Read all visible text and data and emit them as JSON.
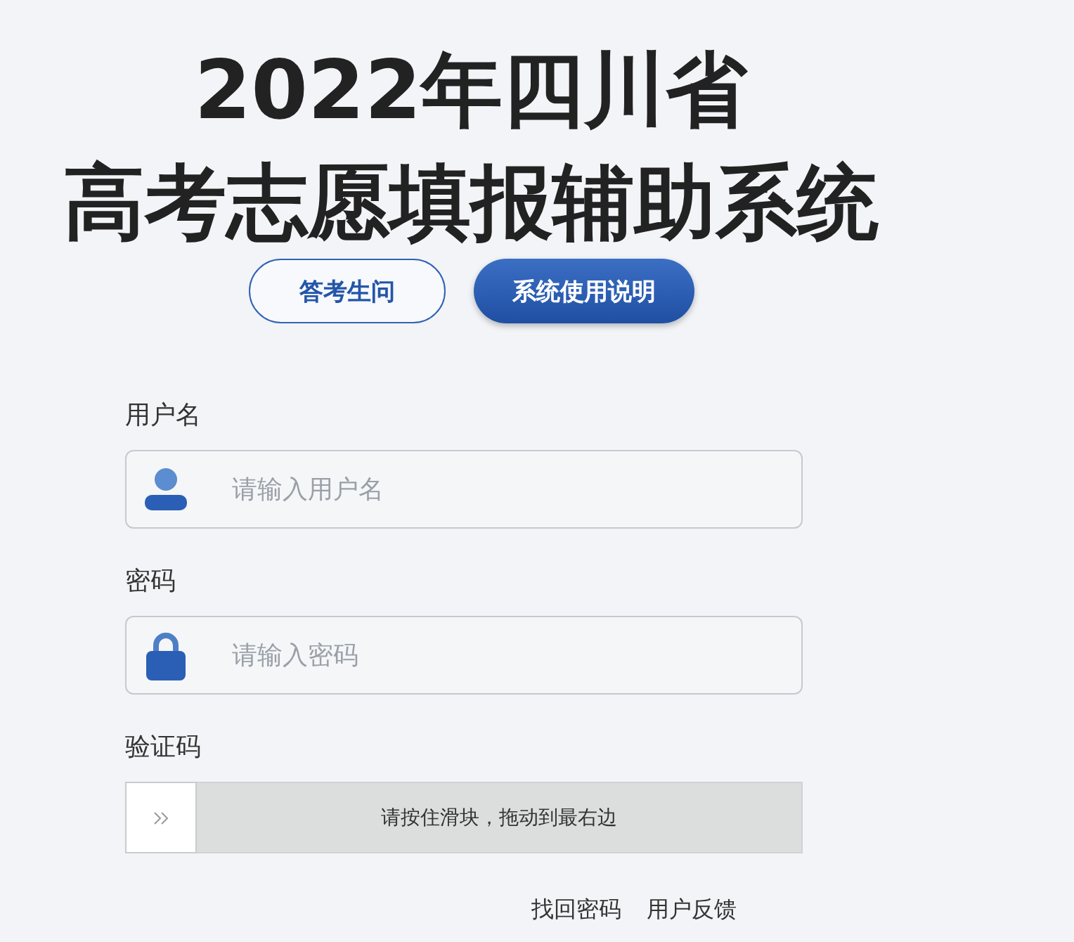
{
  "title_lines": [
    "2022年四川省",
    "高考志愿填报辅助系统"
  ],
  "buttons": [
    {
      "label": "答考生问",
      "kind": "outline"
    },
    {
      "label": "系统使用说明",
      "kind": "filled"
    }
  ],
  "fields": [
    {
      "label": "用户名",
      "kind": "user",
      "placeholder": "请输入用户名"
    },
    {
      "label": "密码",
      "kind": "lock",
      "placeholder": "请输入密码"
    }
  ],
  "captcha": {
    "label": "验证码",
    "hint": "请按住滑块，拖动到最右边",
    "level": 0
  },
  "links": [
    "找回密码",
    "用户反馈"
  ]
}
